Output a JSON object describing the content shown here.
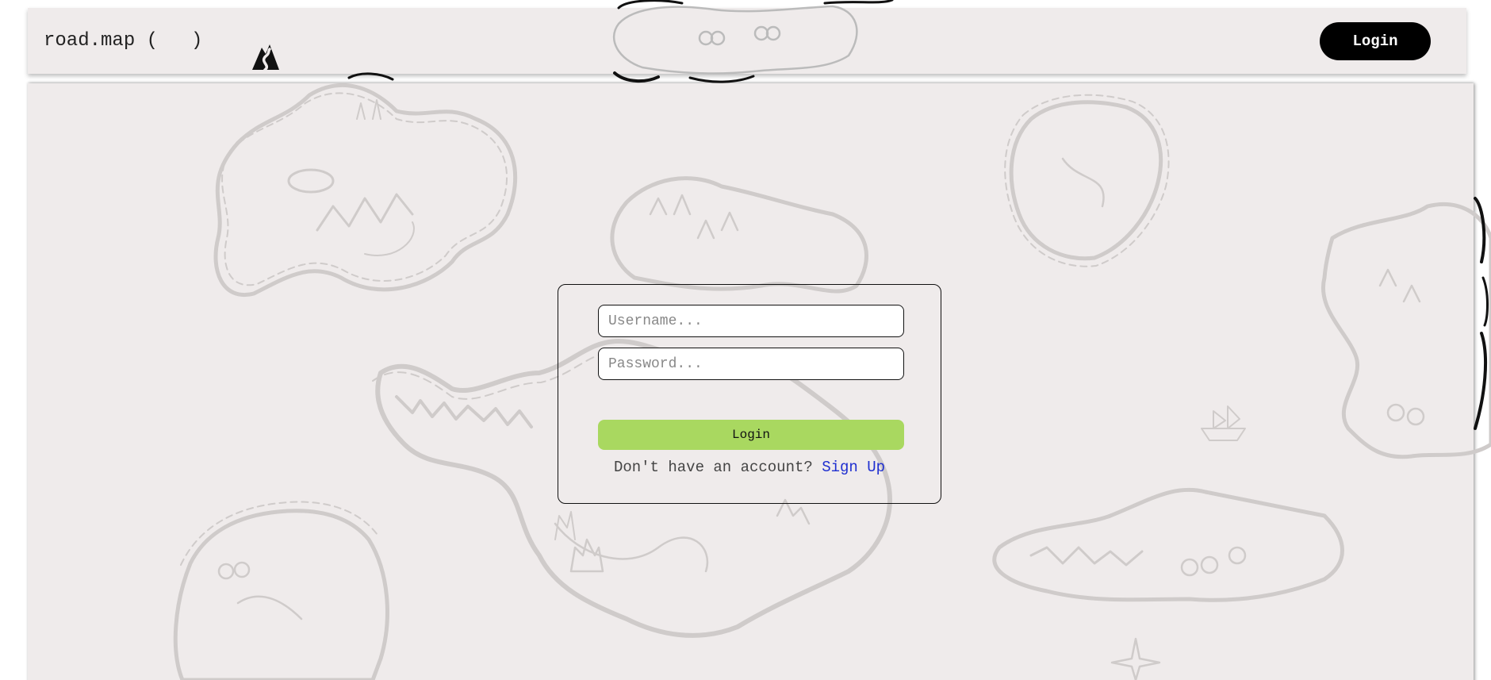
{
  "header": {
    "brand_prefix": "road.map (",
    "brand_suffix": ")",
    "logo_icon": "mountain-road-icon",
    "login_label": "Login"
  },
  "login_form": {
    "username_placeholder": "Username...",
    "password_placeholder": "Password...",
    "submit_label": "Login",
    "signup_prompt": "Don't have an account? ",
    "signup_link": "Sign Up"
  },
  "theme": {
    "background": "#efebeb",
    "map_ink": "#cfcbca",
    "submit_color": "#a9d860",
    "link_color": "#1f2fd0",
    "header_button": "#000000"
  },
  "background_icons": [
    "island-map-illustration",
    "compass-rose-icon",
    "ship-icon"
  ]
}
